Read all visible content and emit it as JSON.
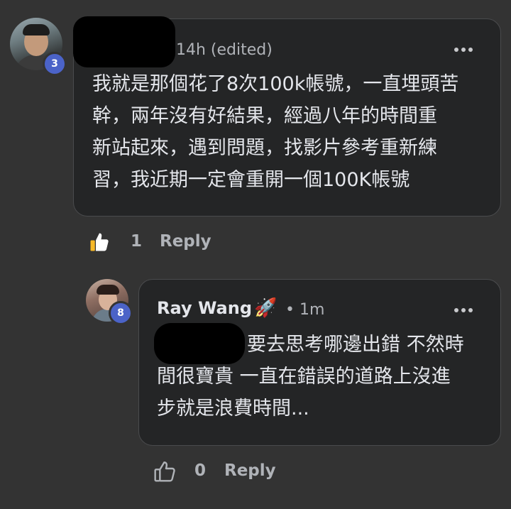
{
  "comment": {
    "badge": "3",
    "time": "14h (edited)",
    "text": "我就是那個花了8次100k帳號，一直埋頭苦\n幹，兩年沒有好結果，經過八年的時間重\n新站起來，遇到問題，找影片參考重新練\n習，我近期一定會重開一個100K帳號",
    "like_count": "1",
    "reply_label": "Reply"
  },
  "reply": {
    "badge": "8",
    "author": "Ray Wang",
    "emoji": "🚀",
    "time": "• 1m",
    "text": "要去思考哪邊出錯 不然時\n間很寶貴 一直在錯誤的道路上沒進\n步就是浪費時間...",
    "like_count": "0",
    "reply_label": "Reply"
  },
  "icons": {
    "avatar": "avatar",
    "more": "more-dots-icon",
    "like_filled": "thumbs-up-filled-icon",
    "like_outline": "thumbs-up-outline-icon"
  }
}
